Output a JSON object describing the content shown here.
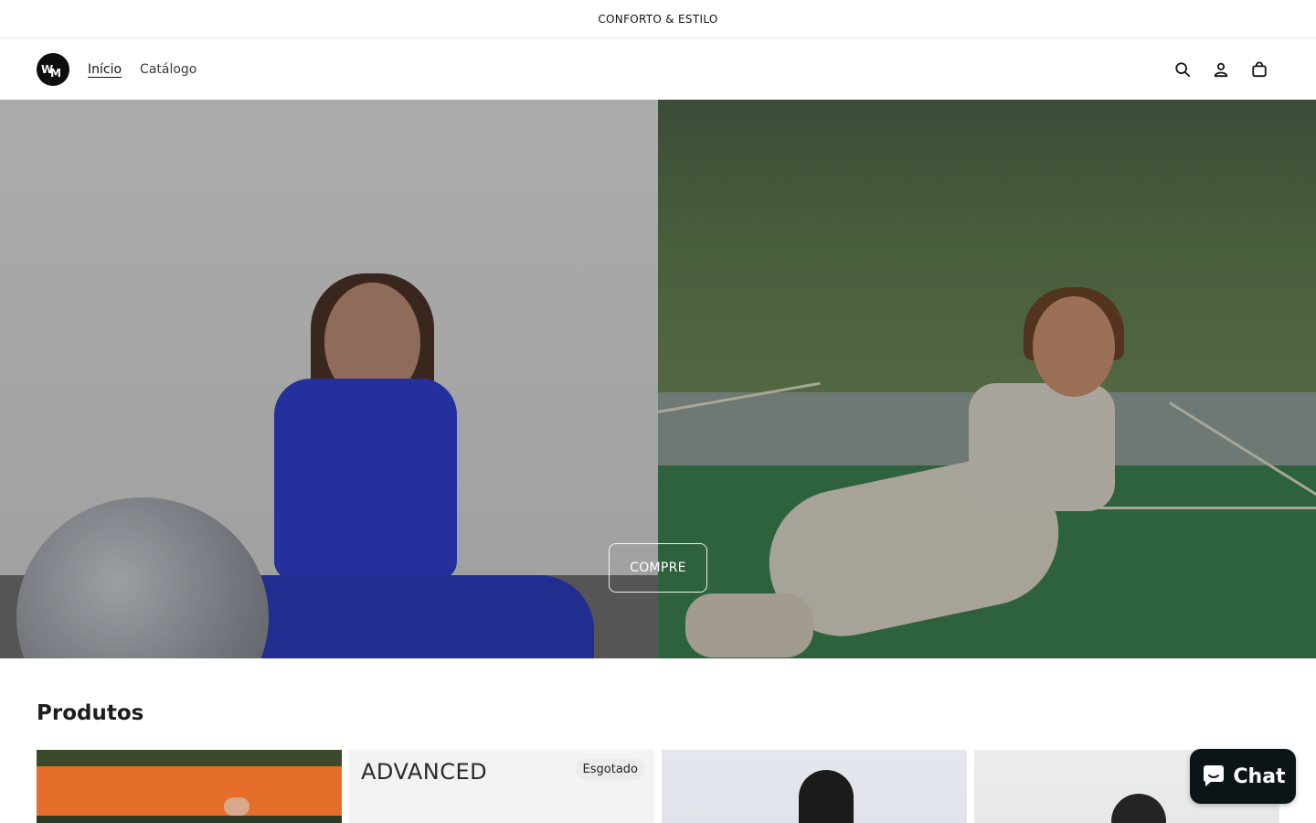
{
  "announcement": {
    "text": "CONFORTO & ESTILO"
  },
  "header": {
    "logo_icon": "wm-monogram-logo",
    "nav": [
      {
        "label": "Início",
        "active": true
      },
      {
        "label": "Catálogo",
        "active": false
      }
    ],
    "icons": [
      "search-icon",
      "account-icon",
      "cart-icon"
    ]
  },
  "hero": {
    "button_label": "COMPRE"
  },
  "products": {
    "title": "Produtos",
    "cards": [
      {
        "title": "",
        "badge": ""
      },
      {
        "title": "ADVANCED",
        "badge": "Esgotado"
      },
      {
        "title": "",
        "badge": ""
      },
      {
        "title": "",
        "badge": ""
      }
    ]
  },
  "chat": {
    "label": "Chat",
    "icon": "chat-bubble-icon"
  },
  "colors": {
    "text": "#121212",
    "chat_bg": "#0b1417",
    "badge_bg": "#ececec"
  }
}
